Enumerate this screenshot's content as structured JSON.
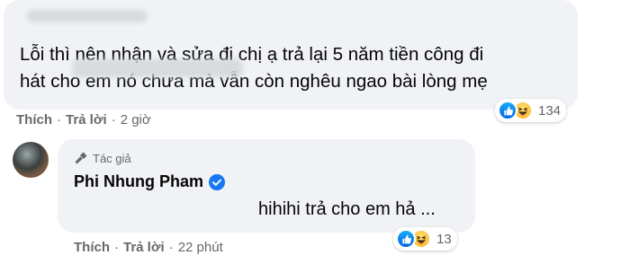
{
  "comment1": {
    "text_line1": "Lỗi thì nên nhận và sửa đi chị ạ trả lại 5 năm tiền công đi",
    "text_line2": "hát cho em nó chưa mà vẫn còn nghêu ngao bài lòng mẹ",
    "actions": {
      "like": "Thích",
      "reply": "Trả lời",
      "time": "2 giờ",
      "separator": "·"
    },
    "reactions": {
      "count": "134",
      "icons": [
        "like-icon",
        "haha-icon"
      ]
    }
  },
  "comment2": {
    "author_badge": "Tác giả",
    "author_name": "Phi Nhung Pham",
    "verified": true,
    "text": "hihihi trả cho em hả ...",
    "actions": {
      "like": "Thích",
      "reply": "Trả lời",
      "time": "22 phút",
      "separator": "·"
    },
    "reactions": {
      "count": "13",
      "icons": [
        "like-icon",
        "haha-icon"
      ]
    }
  },
  "colors": {
    "bubble": "#f0f2f5",
    "text": "#050505",
    "secondary_text": "#65676b",
    "like_blue": "#1877f2",
    "verified_blue": "#1877f2"
  }
}
